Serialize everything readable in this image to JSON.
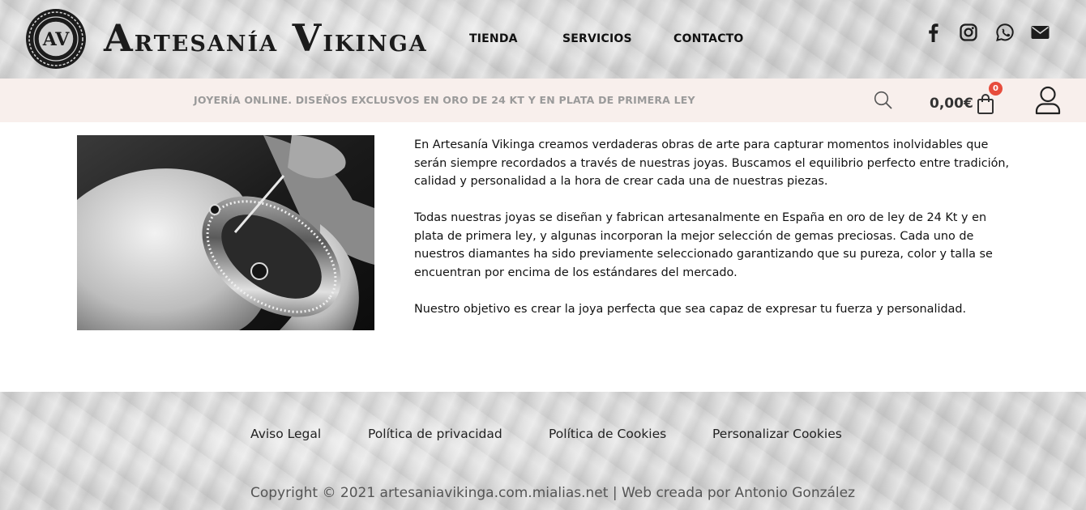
{
  "header": {
    "brand": {
      "words": [
        {
          "cap": "A",
          "rest": "RTESANÍA"
        },
        {
          "cap": "V",
          "rest": "IKINGA"
        }
      ],
      "emblem_letters": "AV"
    },
    "nav": [
      {
        "label": "TIENDA"
      },
      {
        "label": "SERVICIOS"
      },
      {
        "label": "CONTACTO"
      }
    ],
    "social_icons": [
      "facebook-icon",
      "instagram-icon",
      "whatsapp-icon",
      "envelope-icon"
    ]
  },
  "promo": {
    "text": "JOYERÍA ONLINE. DISEÑOS EXCLUSVOS EN ORO DE 24 KT Y EN PLATA DE PRIMERA LEY",
    "cart_total": "0,00€",
    "cart_count": "0"
  },
  "main": {
    "paragraphs": [
      "En Artesanía Vikinga creamos verdaderas obras de arte para capturar momentos inolvidables que serán siempre recordados a través de nuestras joyas. Buscamos el equilibrio perfecto entre tradición, calidad y personalidad a la hora de crear cada una de nuestras piezas.",
      "Todas nuestras joyas se diseñan y fabrican artesanalmente en España en oro de ley de 24 Kt y en plata de primera ley, y algunas incorporan la mejor selección de gemas preciosas. Cada uno de nuestros diamantes ha sido previamente seleccionado garantizando que su pureza, color y talla se encuentran por encima de los estándares del mercado.",
      "Nuestro objetivo es crear la joya perfecta que sea capaz de expresar tu fuerza y personalidad."
    ]
  },
  "footer": {
    "links": [
      {
        "label": "Aviso Legal"
      },
      {
        "label": "Política de privacidad"
      },
      {
        "label": "Política de Cookies"
      },
      {
        "label": "Personalizar Cookies"
      }
    ],
    "copyright": "Copyright © 2021 artesaniavikinga.com.mialias.net | Web creada por Antonio González"
  },
  "colors": {
    "promo_bg": "#f8efec",
    "promo_text": "#9a9a9a",
    "badge": "#e74c3c"
  }
}
